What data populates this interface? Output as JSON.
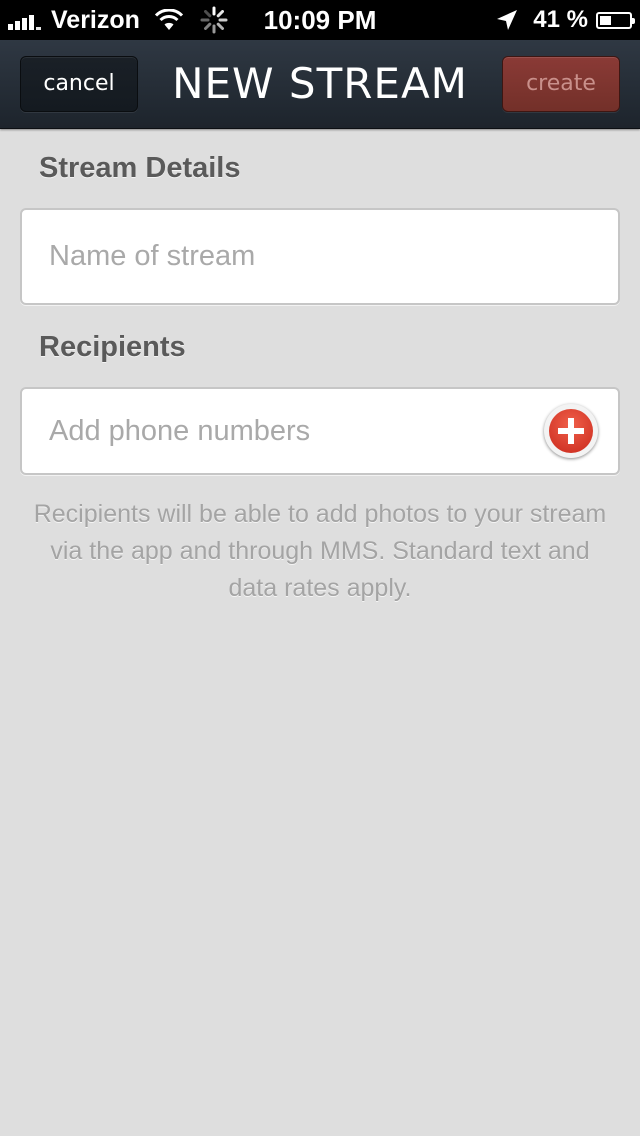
{
  "status_bar": {
    "carrier": "Verizon",
    "time": "10:09 PM",
    "battery": "41 %",
    "battery_level": 0.41,
    "icons": [
      "signal-bars-icon",
      "wifi-icon",
      "activity-spinner-icon",
      "location-arrow-icon",
      "battery-icon"
    ]
  },
  "nav": {
    "title": "NEW STREAM",
    "cancel_label": "cancel",
    "create_label": "create"
  },
  "stream_details": {
    "heading": "Stream Details",
    "name_placeholder": "Name of stream",
    "name_value": ""
  },
  "recipients": {
    "heading": "Recipients",
    "phone_placeholder": "Add phone numbers",
    "phone_value": "",
    "add_icon": "plus-circle-icon",
    "helper_text": "Recipients will be able to add photos to your stream via the app and through MMS. Standard text and data rates apply."
  },
  "colors": {
    "background": "#dedede",
    "nav_bar": "#1d242c",
    "create_button": "#7f352f",
    "add_button": "#d9372a"
  }
}
